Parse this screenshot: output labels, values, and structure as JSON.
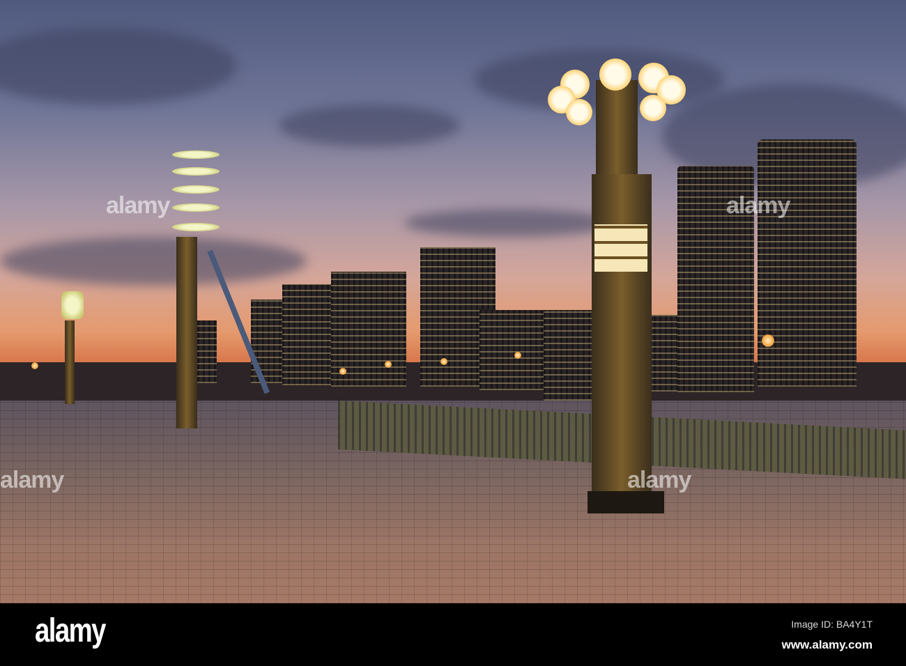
{
  "photo": {
    "subject": "Waterfront promenade with lamp posts and city skyline at dusk",
    "watermark_text": "alamy"
  },
  "footer": {
    "logo": "alamy",
    "image_id": "Image ID: BA4Y1T",
    "website": "www.alamy.com"
  }
}
